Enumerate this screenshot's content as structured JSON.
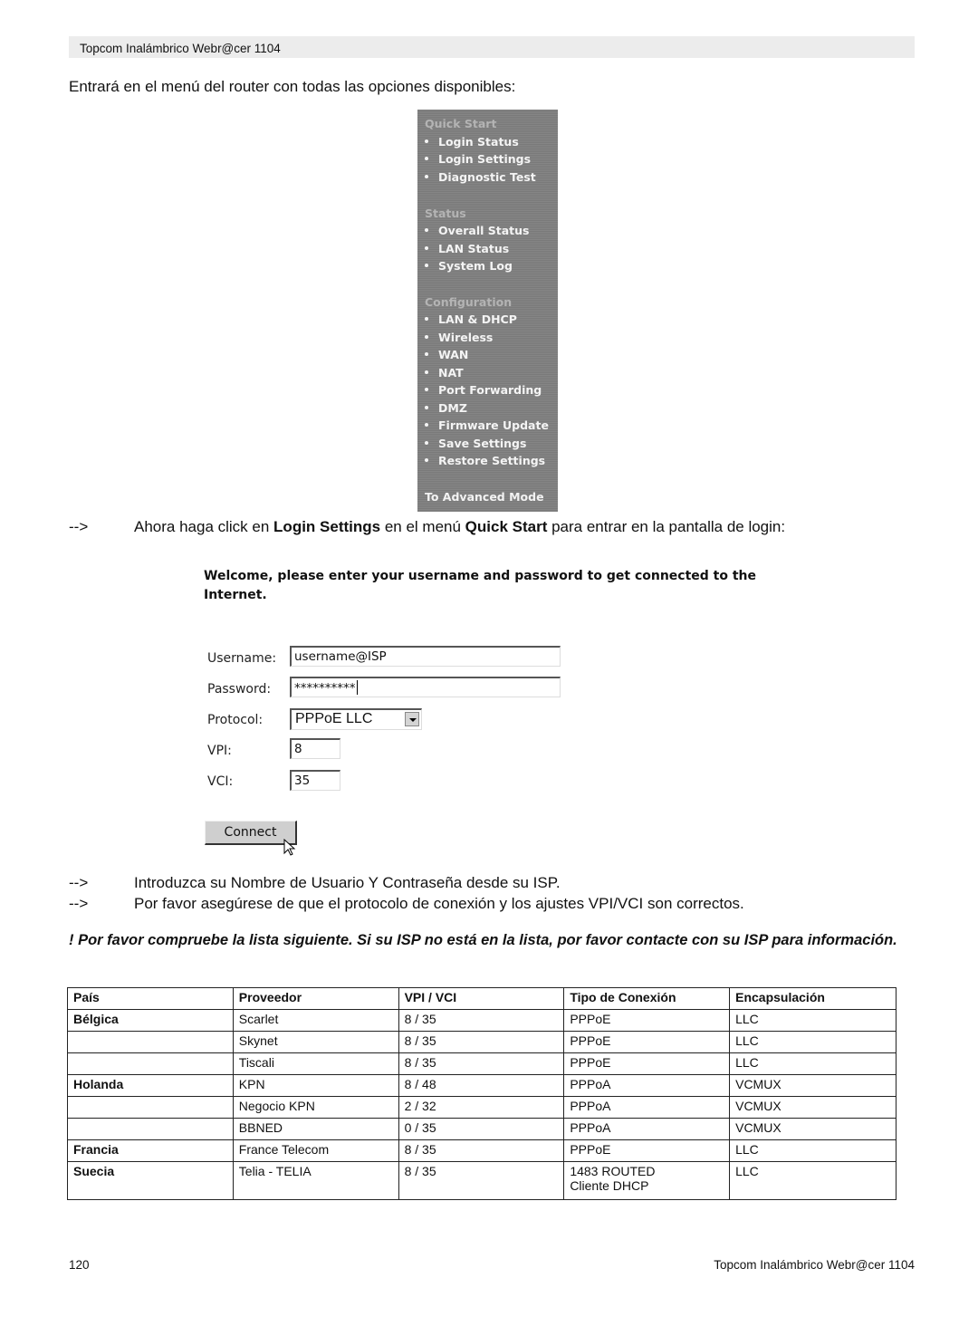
{
  "header": {
    "title": "Topcom Inalámbrico Webr@cer 1104"
  },
  "intro": "Entrará en el menú del router con todas las opciones disponibles:",
  "router_menu": {
    "sections": [
      {
        "title": "Quick Start",
        "items": [
          "Login Status",
          "Login Settings",
          "Diagnostic Test"
        ]
      },
      {
        "title": "Status",
        "items": [
          "Overall Status",
          "LAN Status",
          "System Log"
        ]
      },
      {
        "title": "Configuration",
        "items": [
          "LAN & DHCP",
          "Wireless",
          "WAN",
          "NAT",
          "Port Forwarding",
          "DMZ",
          "Firmware Update",
          "Save Settings",
          "Restore Settings"
        ]
      }
    ],
    "advanced_link": "To Advanced Mode"
  },
  "instruction1": {
    "arrow": "-->",
    "pre": "Ahora haga click en ",
    "bold1": "Login Settings",
    "mid": " en el menú ",
    "bold2": "Quick Start",
    "post": " para entrar en la pantalla de login:"
  },
  "login_form": {
    "welcome": "Welcome, please enter your username and password to get connected to the Internet.",
    "username_label": "Username:",
    "username_value": "username@ISP",
    "password_label": "Password:",
    "password_value": "**********",
    "protocol_label": "Protocol:",
    "protocol_value": "PPPoE LLC",
    "vpi_label": "VPI:",
    "vpi_value": "8",
    "vci_label": "VCI:",
    "vci_value": "35",
    "connect_label": "Connect"
  },
  "instruction2": {
    "arrow": "-->",
    "text": "Introduzca su Nombre de Usuario Y Contraseña desde su ISP."
  },
  "instruction3": {
    "arrow": "-->",
    "text": "Por favor asegúrese de que el protocolo de conexión y los ajustes VPI/VCI son correctos."
  },
  "warning": "! Por favor compruebe la lista siguiente. Si su ISP no está en la lista, por favor contacte con su ISP para información.",
  "isp_table": {
    "headers": [
      "País",
      "Proveedor",
      "VPI / VCI",
      "Tipo de Conexión",
      "Encapsulación"
    ],
    "rows": [
      [
        "Bélgica",
        "Scarlet",
        "8 / 35",
        "PPPoE",
        "LLC"
      ],
      [
        "",
        "Skynet",
        "8 / 35",
        "PPPoE",
        "LLC"
      ],
      [
        "",
        "Tiscali",
        "8 / 35",
        "PPPoE",
        "LLC"
      ],
      [
        "Holanda",
        "KPN",
        "8 / 48",
        "PPPoA",
        "VCMUX"
      ],
      [
        "",
        "Negocio KPN",
        "2 / 32",
        "PPPoA",
        "VCMUX"
      ],
      [
        "",
        "BBNED",
        "0 / 35",
        "PPPoA",
        "VCMUX"
      ],
      [
        "Francia",
        "France Telecom",
        "8 / 35",
        "PPPoE",
        "LLC"
      ],
      [
        "Suecia",
        "Telia - TELIA",
        "8 / 35",
        "1483 ROUTED\nCliente DHCP",
        "LLC"
      ]
    ]
  },
  "footer": {
    "page_number": "120",
    "title": "Topcom Inalámbrico Webr@cer 1104"
  }
}
